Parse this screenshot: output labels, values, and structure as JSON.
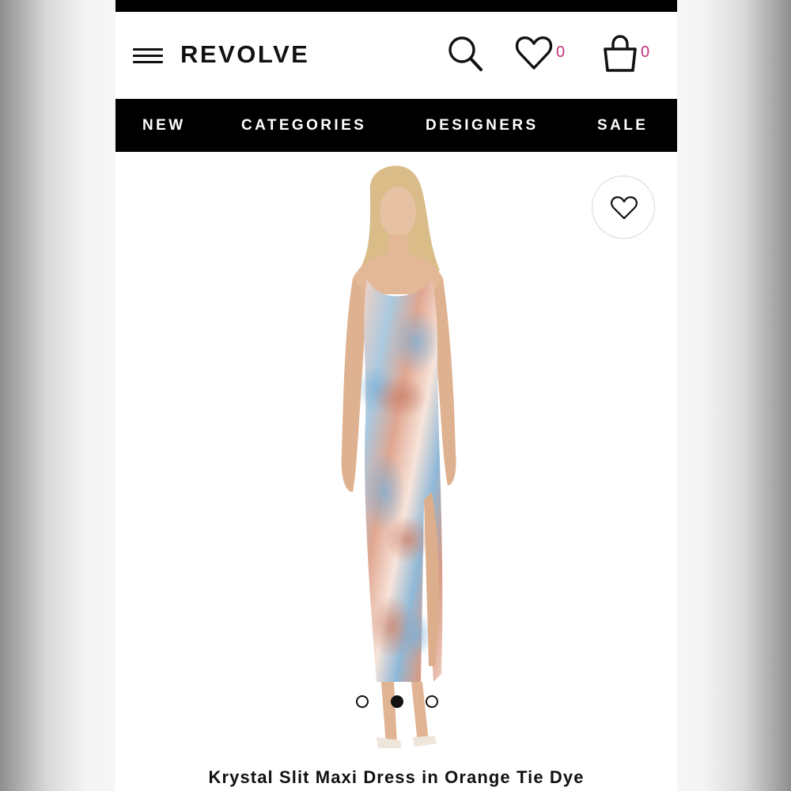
{
  "header": {
    "brand": "REVOLVE",
    "wishlist_count": "0",
    "cart_count": "0",
    "badge_color": "#c1307a"
  },
  "nav": {
    "items": [
      {
        "label": "NEW"
      },
      {
        "label": "CATEGORIES"
      },
      {
        "label": "DESIGNERS"
      },
      {
        "label": "SALE"
      }
    ]
  },
  "product": {
    "title": "Krystal Slit Maxi Dress in Orange Tie Dye",
    "image_count": 3,
    "active_image_index": 1
  },
  "icons": [
    "menu-icon",
    "search-icon",
    "heart-icon",
    "shopping-bag-icon",
    "heart-outline-icon"
  ]
}
